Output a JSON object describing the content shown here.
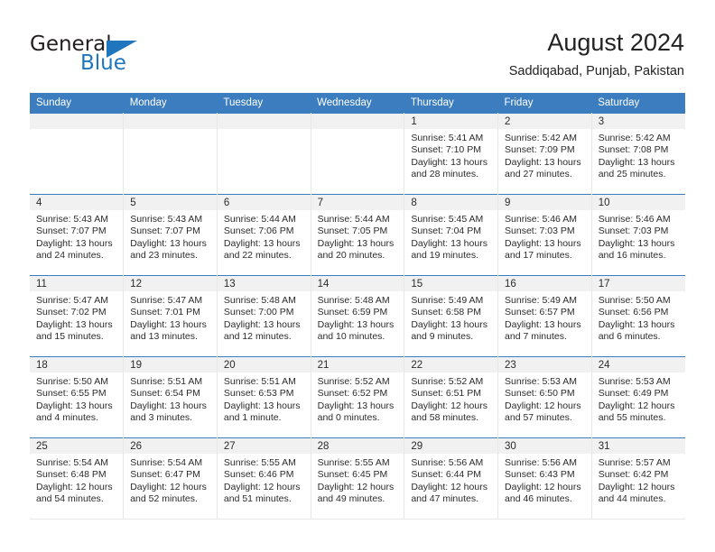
{
  "brand": {
    "name_part1": "General",
    "name_part2": "Blue",
    "flag_icon": "triangle-flag-icon"
  },
  "header": {
    "title": "August 2024",
    "subtitle": "Saddiqabad, Punjab, Pakistan"
  },
  "colors": {
    "header_blue": "#3b7dbf",
    "brand_blue": "#1f76bd",
    "daynum_bg": "#f1f1f1",
    "cell_border": "#e7e7e7"
  },
  "weekdays": [
    "Sunday",
    "Monday",
    "Tuesday",
    "Wednesday",
    "Thursday",
    "Friday",
    "Saturday"
  ],
  "labels": {
    "sunrise_prefix": "Sunrise:",
    "sunset_prefix": "Sunset:",
    "daylight_prefix": "Daylight:"
  },
  "weeks": [
    [
      {
        "day": "",
        "sunrise": "",
        "sunset": "",
        "daylight": ""
      },
      {
        "day": "",
        "sunrise": "",
        "sunset": "",
        "daylight": ""
      },
      {
        "day": "",
        "sunrise": "",
        "sunset": "",
        "daylight": ""
      },
      {
        "day": "",
        "sunrise": "",
        "sunset": "",
        "daylight": ""
      },
      {
        "day": "1",
        "sunrise": "Sunrise: 5:41 AM",
        "sunset": "Sunset: 7:10 PM",
        "daylight": "Daylight: 13 hours and 28 minutes."
      },
      {
        "day": "2",
        "sunrise": "Sunrise: 5:42 AM",
        "sunset": "Sunset: 7:09 PM",
        "daylight": "Daylight: 13 hours and 27 minutes."
      },
      {
        "day": "3",
        "sunrise": "Sunrise: 5:42 AM",
        "sunset": "Sunset: 7:08 PM",
        "daylight": "Daylight: 13 hours and 25 minutes."
      }
    ],
    [
      {
        "day": "4",
        "sunrise": "Sunrise: 5:43 AM",
        "sunset": "Sunset: 7:07 PM",
        "daylight": "Daylight: 13 hours and 24 minutes."
      },
      {
        "day": "5",
        "sunrise": "Sunrise: 5:43 AM",
        "sunset": "Sunset: 7:07 PM",
        "daylight": "Daylight: 13 hours and 23 minutes."
      },
      {
        "day": "6",
        "sunrise": "Sunrise: 5:44 AM",
        "sunset": "Sunset: 7:06 PM",
        "daylight": "Daylight: 13 hours and 22 minutes."
      },
      {
        "day": "7",
        "sunrise": "Sunrise: 5:44 AM",
        "sunset": "Sunset: 7:05 PM",
        "daylight": "Daylight: 13 hours and 20 minutes."
      },
      {
        "day": "8",
        "sunrise": "Sunrise: 5:45 AM",
        "sunset": "Sunset: 7:04 PM",
        "daylight": "Daylight: 13 hours and 19 minutes."
      },
      {
        "day": "9",
        "sunrise": "Sunrise: 5:46 AM",
        "sunset": "Sunset: 7:03 PM",
        "daylight": "Daylight: 13 hours and 17 minutes."
      },
      {
        "day": "10",
        "sunrise": "Sunrise: 5:46 AM",
        "sunset": "Sunset: 7:03 PM",
        "daylight": "Daylight: 13 hours and 16 minutes."
      }
    ],
    [
      {
        "day": "11",
        "sunrise": "Sunrise: 5:47 AM",
        "sunset": "Sunset: 7:02 PM",
        "daylight": "Daylight: 13 hours and 15 minutes."
      },
      {
        "day": "12",
        "sunrise": "Sunrise: 5:47 AM",
        "sunset": "Sunset: 7:01 PM",
        "daylight": "Daylight: 13 hours and 13 minutes."
      },
      {
        "day": "13",
        "sunrise": "Sunrise: 5:48 AM",
        "sunset": "Sunset: 7:00 PM",
        "daylight": "Daylight: 13 hours and 12 minutes."
      },
      {
        "day": "14",
        "sunrise": "Sunrise: 5:48 AM",
        "sunset": "Sunset: 6:59 PM",
        "daylight": "Daylight: 13 hours and 10 minutes."
      },
      {
        "day": "15",
        "sunrise": "Sunrise: 5:49 AM",
        "sunset": "Sunset: 6:58 PM",
        "daylight": "Daylight: 13 hours and 9 minutes."
      },
      {
        "day": "16",
        "sunrise": "Sunrise: 5:49 AM",
        "sunset": "Sunset: 6:57 PM",
        "daylight": "Daylight: 13 hours and 7 minutes."
      },
      {
        "day": "17",
        "sunrise": "Sunrise: 5:50 AM",
        "sunset": "Sunset: 6:56 PM",
        "daylight": "Daylight: 13 hours and 6 minutes."
      }
    ],
    [
      {
        "day": "18",
        "sunrise": "Sunrise: 5:50 AM",
        "sunset": "Sunset: 6:55 PM",
        "daylight": "Daylight: 13 hours and 4 minutes."
      },
      {
        "day": "19",
        "sunrise": "Sunrise: 5:51 AM",
        "sunset": "Sunset: 6:54 PM",
        "daylight": "Daylight: 13 hours and 3 minutes."
      },
      {
        "day": "20",
        "sunrise": "Sunrise: 5:51 AM",
        "sunset": "Sunset: 6:53 PM",
        "daylight": "Daylight: 13 hours and 1 minute."
      },
      {
        "day": "21",
        "sunrise": "Sunrise: 5:52 AM",
        "sunset": "Sunset: 6:52 PM",
        "daylight": "Daylight: 13 hours and 0 minutes."
      },
      {
        "day": "22",
        "sunrise": "Sunrise: 5:52 AM",
        "sunset": "Sunset: 6:51 PM",
        "daylight": "Daylight: 12 hours and 58 minutes."
      },
      {
        "day": "23",
        "sunrise": "Sunrise: 5:53 AM",
        "sunset": "Sunset: 6:50 PM",
        "daylight": "Daylight: 12 hours and 57 minutes."
      },
      {
        "day": "24",
        "sunrise": "Sunrise: 5:53 AM",
        "sunset": "Sunset: 6:49 PM",
        "daylight": "Daylight: 12 hours and 55 minutes."
      }
    ],
    [
      {
        "day": "25",
        "sunrise": "Sunrise: 5:54 AM",
        "sunset": "Sunset: 6:48 PM",
        "daylight": "Daylight: 12 hours and 54 minutes."
      },
      {
        "day": "26",
        "sunrise": "Sunrise: 5:54 AM",
        "sunset": "Sunset: 6:47 PM",
        "daylight": "Daylight: 12 hours and 52 minutes."
      },
      {
        "day": "27",
        "sunrise": "Sunrise: 5:55 AM",
        "sunset": "Sunset: 6:46 PM",
        "daylight": "Daylight: 12 hours and 51 minutes."
      },
      {
        "day": "28",
        "sunrise": "Sunrise: 5:55 AM",
        "sunset": "Sunset: 6:45 PM",
        "daylight": "Daylight: 12 hours and 49 minutes."
      },
      {
        "day": "29",
        "sunrise": "Sunrise: 5:56 AM",
        "sunset": "Sunset: 6:44 PM",
        "daylight": "Daylight: 12 hours and 47 minutes."
      },
      {
        "day": "30",
        "sunrise": "Sunrise: 5:56 AM",
        "sunset": "Sunset: 6:43 PM",
        "daylight": "Daylight: 12 hours and 46 minutes."
      },
      {
        "day": "31",
        "sunrise": "Sunrise: 5:57 AM",
        "sunset": "Sunset: 6:42 PM",
        "daylight": "Daylight: 12 hours and 44 minutes."
      }
    ]
  ]
}
